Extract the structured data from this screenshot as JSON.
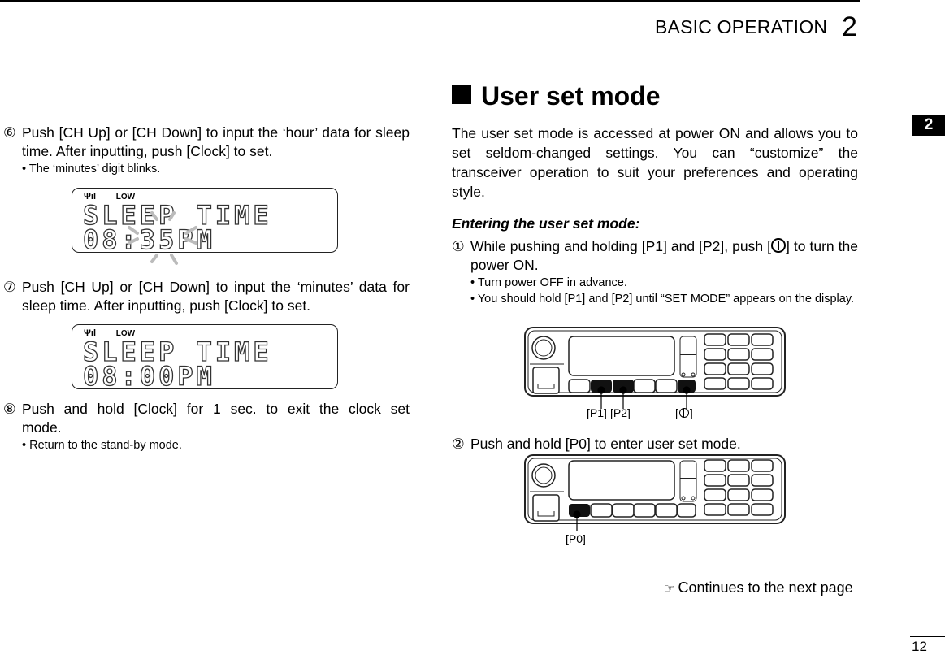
{
  "header": {
    "section_title": "BASIC OPERATION",
    "chapter_number": "2",
    "tab_marker": "2"
  },
  "left_column": {
    "steps": [
      {
        "number": "⑥",
        "text": "Push [CH Up] or [CH Down] to input the ‘hour’ data for sleep time. After inputting, push [Clock] to set.",
        "notes": [
          "• The ‘minutes’ digit blinks."
        ],
        "display": {
          "indicators": [
            "antenna-signal-icon",
            "LOW"
          ],
          "line1": "SLEEP TIME",
          "line2": "08:35PM",
          "blinking": "minutes"
        }
      },
      {
        "number": "⑦",
        "text": "Push [CH Up] or [CH Down] to input the ‘minutes’ data for sleep time. After inputting, push [Clock] to set.",
        "notes": [],
        "display": {
          "indicators": [
            "antenna-signal-icon",
            "LOW"
          ],
          "line1": "SLEEP TIME",
          "line2": "08:00PM"
        }
      },
      {
        "number": "⑧",
        "text": "Push and hold [Clock] for 1 sec. to exit the clock set mode.",
        "notes": [
          "• Return to the stand-by mode."
        ]
      }
    ],
    "lcd_low_label": "LOW",
    "lcd_antenna_glyph": "Ψıl"
  },
  "right_column": {
    "section_heading": "User set mode",
    "intro": "The user set mode is accessed at power ON and allows you to set seldom-changed settings. You can “customize” the transceiver operation to suit your preferences and operating style.",
    "subheading": "Entering the user set mode:",
    "steps": [
      {
        "number": "①",
        "text_before_icon": "While pushing and holding [P1] and [P2], push [",
        "text_after_icon": "] to turn the power ON.",
        "notes": [
          "• Turn power OFF in advance.",
          "• You should hold [P1] and [P2] until “SET MODE” appears on the display."
        ],
        "figure_labels": [
          "[P1]",
          "[P2]",
          "[",
          "]"
        ]
      },
      {
        "number": "②",
        "text": "Push and hold [P0] to enter user set mode.",
        "figure_labels": [
          "[P0]"
        ]
      }
    ],
    "continues": "Continues to the next page",
    "continues_icon": "☞"
  },
  "footer": {
    "page_number": "12"
  }
}
